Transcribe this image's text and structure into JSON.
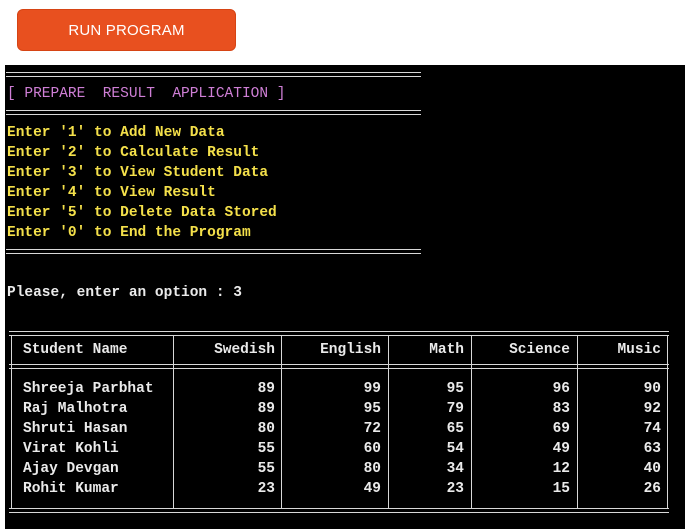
{
  "run_button": {
    "label": "RUN PROGRAM"
  },
  "terminal": {
    "header": "[ PREPARE  RESULT  APPLICATION ]",
    "menu": [
      "Enter '1' to Add New Data",
      "Enter '2' to Calculate Result",
      "Enter '3' to View Student Data",
      "Enter '4' to View Result",
      "Enter '5' to Delete Data Stored",
      "Enter '0' to End the Program"
    ],
    "prompt": "Please, enter an option : 3",
    "table": {
      "headers": [
        "Student Name",
        "Swedish",
        "English",
        "Math",
        "Science",
        "Music"
      ],
      "rows": [
        [
          "Shreeja Parbhat",
          "89",
          "99",
          "95",
          "96",
          "90"
        ],
        [
          "Raj Malhotra",
          "89",
          "95",
          "79",
          "83",
          "92"
        ],
        [
          "Shruti Hasan",
          "80",
          "72",
          "65",
          "69",
          "74"
        ],
        [
          "Virat Kohli",
          "55",
          "60",
          "54",
          "49",
          "63"
        ],
        [
          "Ajay Devgan",
          "55",
          "80",
          "34",
          "12",
          "40"
        ],
        [
          "Rohit Kumar",
          "23",
          "49",
          "23",
          "15",
          "26"
        ]
      ]
    }
  },
  "colors": {
    "button": "#e8501f",
    "terminal_bg": "#000000",
    "header_text": "#cf7fd6",
    "menu_text": "#f4e04a",
    "plain_text": "#eaeaea"
  }
}
